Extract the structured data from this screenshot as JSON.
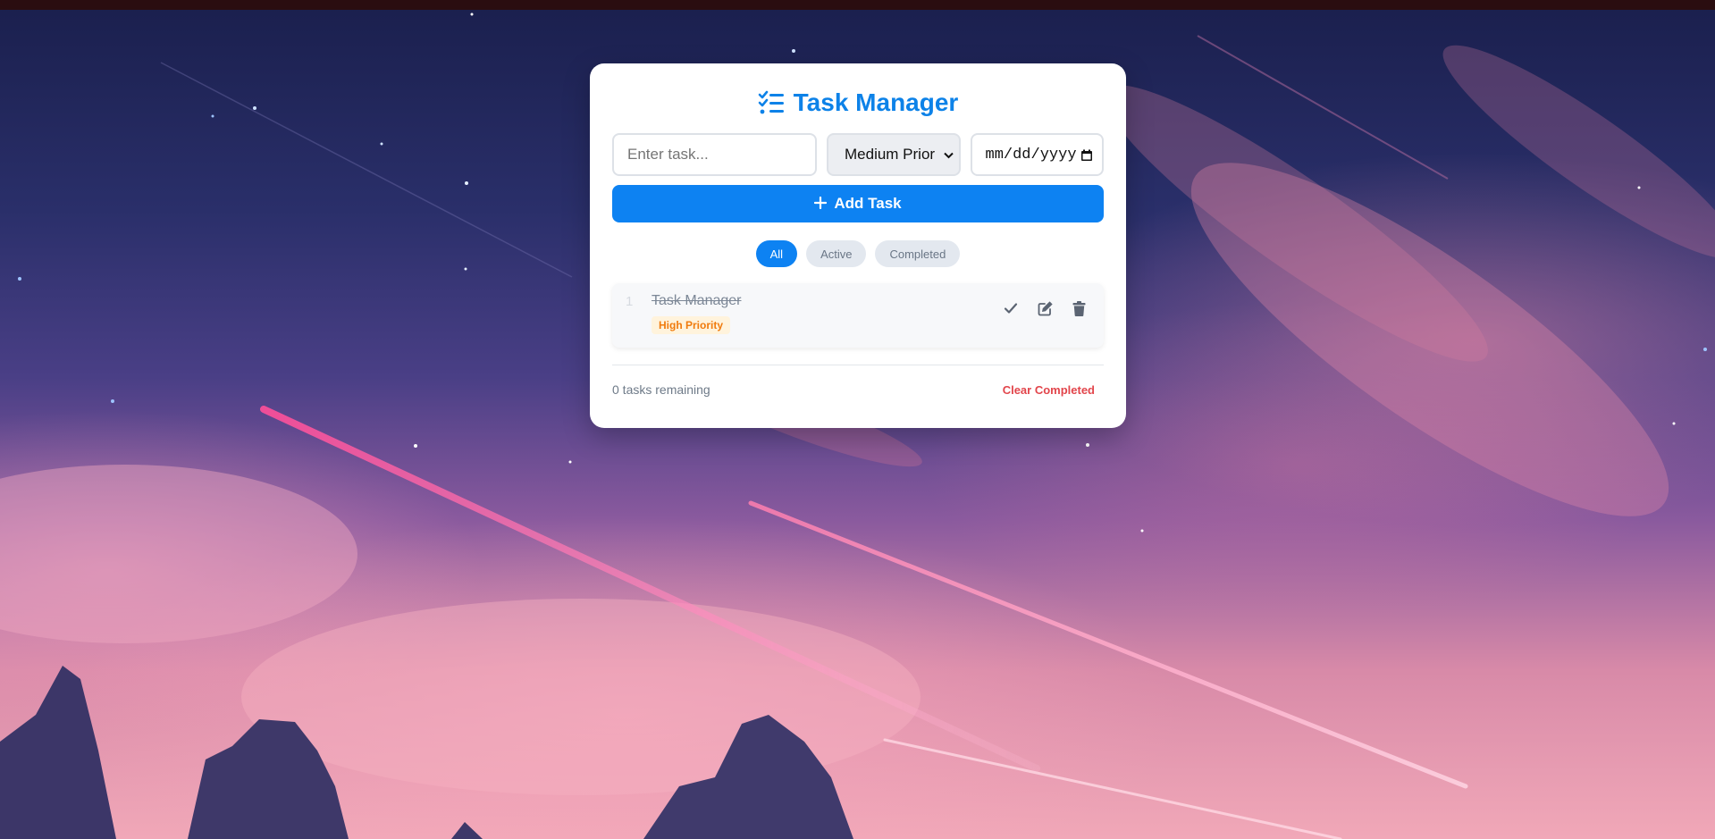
{
  "app": {
    "title": "Task Manager"
  },
  "form": {
    "task_placeholder": "Enter task...",
    "task_value": "",
    "priority_selected": "Medium Prior",
    "date_value": "mm/dd/yyyy",
    "add_button_label": "Add Task"
  },
  "filters": [
    {
      "label": "All",
      "active": true
    },
    {
      "label": "Active",
      "active": false
    },
    {
      "label": "Completed",
      "active": false
    }
  ],
  "tasks": [
    {
      "number": "1",
      "text": "Task Manager",
      "priority_label": "High Priority",
      "completed": true
    }
  ],
  "footer": {
    "remaining_text": "0 tasks remaining",
    "clear_label": "Clear Completed"
  },
  "colors": {
    "accent": "#0d82f2",
    "title": "#0d82e8",
    "danger": "#e2454b",
    "priority_high": "#f07b0d"
  },
  "icons": {
    "title_icon": "list-check-icon",
    "add_icon": "plus-icon",
    "complete_icon": "check-icon",
    "edit_icon": "edit-icon",
    "delete_icon": "trash-icon",
    "date_icon": "calendar-icon"
  }
}
